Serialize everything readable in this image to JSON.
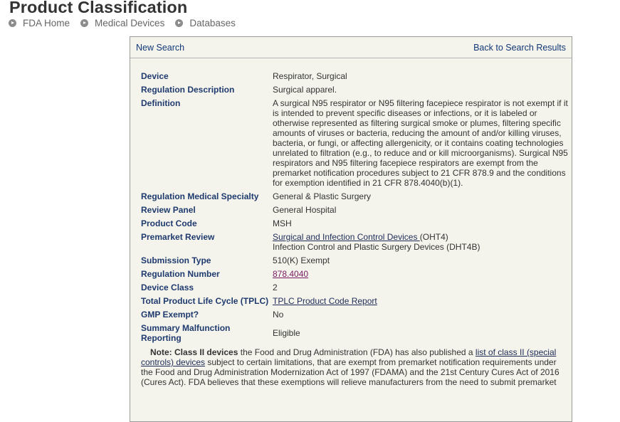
{
  "page": {
    "title": "Product Classification"
  },
  "breadcrumb": [
    {
      "label": "FDA Home"
    },
    {
      "label": "Medical Devices"
    },
    {
      "label": "Databases"
    }
  ],
  "header": {
    "new_search": "New Search",
    "back": "Back to Search Results"
  },
  "fields": {
    "device": {
      "label": "Device",
      "value": "Respirator, Surgical"
    },
    "regdesc": {
      "label": "Regulation Description",
      "value": "Surgical apparel."
    },
    "definition": {
      "label": "Definition",
      "value": "A surgical N95 respirator or N95 filtering facepiece respirator is not exempt if it is intended to prevent specific diseases or infections, or it is labeled or otherwise represented as filtering surgical smoke or plumes, filtering specific amounts of viruses or bacteria, reducing the amount of and/or killing viruses, bacteria, or fungi, or affecting allergenicity, or it contains coating technologies unrelated to filtration (e.g., to reduce and or kill microorganisms).  Surgical N95 respirators and N95 filtering facepiece respirators are exempt from the premarket notification procedures subject to 21 CFR 878.9 and the conditions for exemption identified in 21 CFR 878.4040(b)(1)."
    },
    "specialty": {
      "label": "Regulation Medical Specialty",
      "value": "General & Plastic Surgery"
    },
    "panel": {
      "label": "Review Panel",
      "value": "General Hospital"
    },
    "code": {
      "label": "Product Code",
      "value": "MSH"
    },
    "premarket": {
      "label": "Premarket Review",
      "link": "Surgical and Infection Control Devices ",
      "suffix": "(OHT4)",
      "line2": "Infection Control and Plastic Surgery Devices (DHT4B)"
    },
    "subtype": {
      "label": "Submission Type",
      "value": "510(K) Exempt"
    },
    "regnum": {
      "label": "Regulation Number",
      "value": "878.4040"
    },
    "class": {
      "label": "Device Class",
      "value": "2"
    },
    "tplc": {
      "label": "Total Product Life Cycle (TPLC)",
      "value": "TPLC Product Code Report"
    },
    "gmp": {
      "label": "GMP Exempt?",
      "value": "No"
    },
    "malfunction": {
      "label": "Summary Malfunction Reporting",
      "value": "Eligible"
    }
  },
  "note": {
    "label": "Note:",
    "bold": "Class II devices",
    "text1": " the Food and Drug Administration (FDA) has also published a ",
    "link": "list of class II (special controls) devices",
    "text2": " subject to certain limitations, that are exempt from premarket notification requirements under the Food and Drug Administration Modernization Act of 1997 (FDAMA) and the 21st Century Cures Act of 2016 (Cures Act). FDA believes that these exemptions will relieve manufacturers from the need to submit premarket"
  }
}
